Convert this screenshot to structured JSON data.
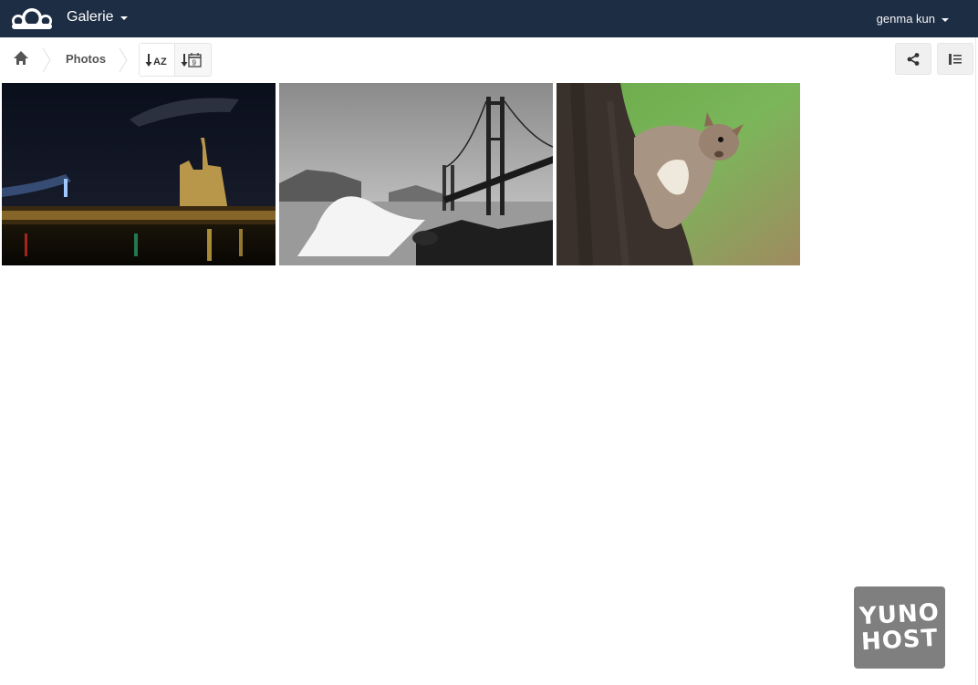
{
  "header": {
    "app_name": "Galerie",
    "user_name": "genma kun",
    "bar_color": "#1d2d44"
  },
  "breadcrumb": {
    "home_icon": "home-icon",
    "items": [
      {
        "label": "Photos"
      }
    ]
  },
  "sort": {
    "by_name_icon": "sort-alpha-icon",
    "by_name_label": "AZ",
    "by_date_icon": "sort-date-icon",
    "by_date_label": "9"
  },
  "toolbar": {
    "share_icon": "share-icon",
    "info_icon": "info-list-icon"
  },
  "gallery": {
    "images": [
      {
        "subject": "night-cathedral-photo"
      },
      {
        "subject": "golden-gate-bridge-photo"
      },
      {
        "subject": "squirrel-photo"
      }
    ]
  },
  "badge": {
    "line1": "YUNO",
    "line2": "HOST",
    "color": "#7f7f7f"
  }
}
